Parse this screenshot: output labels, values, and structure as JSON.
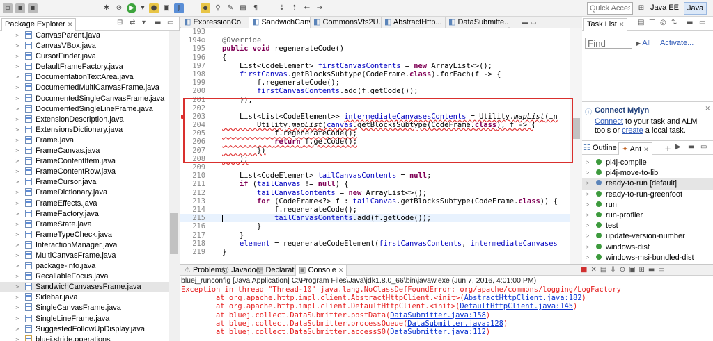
{
  "toolbar": {
    "quick_access": "Quick Access",
    "perspectives": [
      "Java EE",
      "Java"
    ]
  },
  "package_explorer": {
    "title": "Package Explorer",
    "items": [
      "CanvasParent.java",
      "CanvasVBox.java",
      "CursorFinder.java",
      "DefaultFrameFactory.java",
      "DocumentationTextArea.java",
      "DocumentedMultiCanvasFrame.java",
      "DocumentedSingleCanvasFrame.java",
      "DocumentedSingleLineFrame.java",
      "ExtensionDescription.java",
      "ExtensionsDictionary.java",
      "Frame.java",
      "FrameCanvas.java",
      "FrameContentItem.java",
      "FrameContentRow.java",
      "FrameCursor.java",
      "FrameDictionary.java",
      "FrameEffects.java",
      "FrameFactory.java",
      "FrameState.java",
      "FrameTypeCheck.java",
      "InteractionManager.java",
      "MultiCanvasFrame.java",
      "package-info.java",
      "RecallableFocus.java",
      "SandwichCanvasesFrame.java",
      "Sidebar.java",
      "SingleCanvasFrame.java",
      "SingleLineFrame.java",
      "SuggestedFollowUpDisplay.java",
      "bluej.stride.operations"
    ],
    "selected_index": 24
  },
  "editor": {
    "tabs": [
      "ExpressionCo...",
      "SandwichCanv...",
      "CommonsVfs2U...",
      "AbstractHttp...",
      "DataSubmitte..."
    ],
    "active_tab": 1
  },
  "code_lines": [
    {
      "n": "193",
      "t": ""
    },
    {
      "n": "194⊖",
      "t": "<span class=\"an\">@Override</span>"
    },
    {
      "n": "195",
      "t": "<span class=\"kw\">public void</span> regenerateCode()"
    },
    {
      "n": "196",
      "t": "{"
    },
    {
      "n": "197",
      "t": "    List&lt;CodeElement&gt; <span class=\"fld\">firstCanvasContents</span> = <span class=\"kw\">new</span> ArrayList&lt;&gt;();"
    },
    {
      "n": "198",
      "t": "    <span class=\"fld\">firstCanvas</span>.getBlocksSubtype(CodeFrame.<span class=\"kw\">class</span>).forEach(f -&gt; {"
    },
    {
      "n": "199",
      "t": "        f.regenerateCode();"
    },
    {
      "n": "200",
      "t": "        <span class=\"fld\">firstCanvasContents</span>.add(f.getCode());"
    },
    {
      "n": "201",
      "t": "    });"
    },
    {
      "n": "202",
      "t": ""
    },
    {
      "n": "203",
      "t": "    List&lt;List&lt;CodeElement&gt;&gt; <span class=\"err\"><span class=\"fld\">intermediateCanvasesContents</span> = Utility.<span class=\"mth\">mapList</span>(in</span>"
    },
    {
      "n": "204",
      "t": "<span class=\"err\">        Utility.<span class=\"mth\">mapList</span>(<span class=\"fld\">canvas</span>.getBlocksSubtype(CodeFrame.<span class=\"kw\">class</span>), f -&gt; {</span>"
    },
    {
      "n": "205",
      "t": "<span class=\"err\">            f.regenerateCode();</span>"
    },
    {
      "n": "206",
      "t": "<span class=\"err\">            <span class=\"kw\">return</span> f.getCode();</span>"
    },
    {
      "n": "207",
      "t": "<span class=\"err\">        })</span>"
    },
    {
      "n": "208",
      "t": "<span class=\"err\">    );</span>"
    },
    {
      "n": "209",
      "t": ""
    },
    {
      "n": "210",
      "t": "    List&lt;CodeElement&gt; <span class=\"fld\">tailCanvasContents</span> = <span class=\"kw\">null</span>;"
    },
    {
      "n": "211",
      "t": "    <span class=\"kw\">if</span> (<span class=\"fld\">tailCanvas</span> != <span class=\"kw\">null</span>) {"
    },
    {
      "n": "212",
      "t": "        <span class=\"fld\">tailCanvasContents</span> = <span class=\"kw\">new</span> ArrayList&lt;&gt;();"
    },
    {
      "n": "213",
      "t": "        <span class=\"kw\">for</span> (CodeFrame&lt;?&gt; f : <span class=\"fld\">tailCanvas</span>.getBlocksSubtype(CodeFrame.<span class=\"kw\">class</span>)) {"
    },
    {
      "n": "214",
      "t": "            f.regenerateCode();"
    },
    {
      "n": "215",
      "t": "            <span class=\"fld\">tailCanvasContents</span>.add(f.getCode());"
    },
    {
      "n": "216",
      "t": "        }"
    },
    {
      "n": "217",
      "t": "    }"
    },
    {
      "n": "218",
      "t": "    <span class=\"fld\">element</span> = regenerateCodeElement(<span class=\"fld\">firstCanvasContents</span>, <span class=\"fld\">intermediateCanvases</span>"
    },
    {
      "n": "219",
      "t": "}"
    }
  ],
  "current_line_index": 22,
  "task_list": {
    "title": "Task List",
    "find_placeholder": "Find",
    "all": "All",
    "activate": "Activate..."
  },
  "mylyn": {
    "title": "Connect Mylyn",
    "connect": "Connect",
    "text1": " to your task and ALM tools or ",
    "create": "create",
    "text2": " a local task."
  },
  "outline": {
    "tabs": [
      "Outline",
      "Ant"
    ],
    "items": [
      "pi4j-compile",
      "pi4j-move-to-lib",
      "ready-to-run [default]",
      "ready-to-run-greenfoot",
      "run",
      "run-profiler",
      "test",
      "update-version-number",
      "windows-dist",
      "windows-msi-bundled-dist"
    ],
    "selected_index": 2
  },
  "console": {
    "tabs": [
      "Problems",
      "Javadoc",
      "Declaration",
      "Console"
    ],
    "active_tab": 3,
    "description": "bluej_runconfig [Java Application] C:\\Program Files\\Java\\jdk1.8.0_66\\bin\\javaw.exe (Jun 7, 2016, 4:01:00 PM)",
    "lines": [
      {
        "pre": "Exception in thread \"Thread-10\" java.lang.NoClassDefFoundError: org/apache/commons/logging/LogFactory",
        "link": "",
        "post": ""
      },
      {
        "pre": "        at org.apache.http.impl.client.AbstractHttpClient.<init>(",
        "link": "AbstractHttpClient.java:182",
        "post": ")"
      },
      {
        "pre": "        at org.apache.http.impl.client.DefaultHttpClient.<init>(",
        "link": "DefaultHttpClient.java:145",
        "post": ")"
      },
      {
        "pre": "        at bluej.collect.DataSubmitter.postData(",
        "link": "DataSubmitter.java:158",
        "post": ")"
      },
      {
        "pre": "        at bluej.collect.DataSubmitter.processQueue(",
        "link": "DataSubmitter.java:128",
        "post": ")"
      },
      {
        "pre": "        at bluej.collect.DataSubmitter.access$0(",
        "link": "DataSubmitter.java:112",
        "post": ")"
      }
    ]
  }
}
